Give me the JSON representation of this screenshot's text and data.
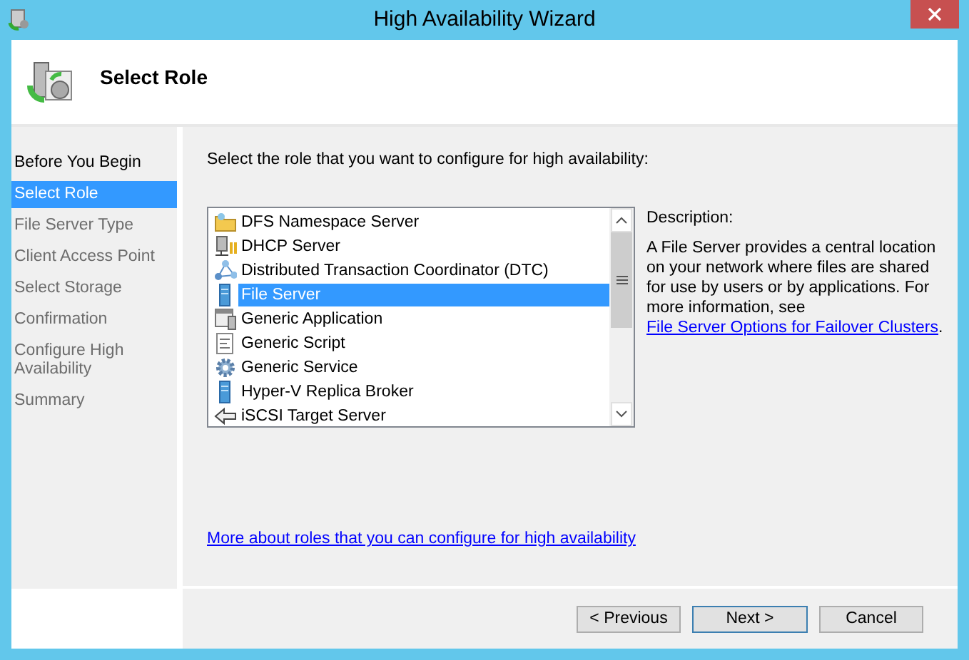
{
  "window": {
    "title": "High Availability Wizard"
  },
  "header": {
    "title": "Select Role"
  },
  "steps": [
    {
      "label": "Before You Begin",
      "selected": false,
      "disabled": false
    },
    {
      "label": "Select Role",
      "selected": true,
      "disabled": false
    },
    {
      "label": "File Server Type",
      "selected": false,
      "disabled": true
    },
    {
      "label": "Client Access Point",
      "selected": false,
      "disabled": true
    },
    {
      "label": "Select Storage",
      "selected": false,
      "disabled": true
    },
    {
      "label": "Confirmation",
      "selected": false,
      "disabled": true
    },
    {
      "label": "Configure High Availability",
      "selected": false,
      "disabled": true
    },
    {
      "label": "Summary",
      "selected": false,
      "disabled": true
    }
  ],
  "instruction": "Select the role that you want to configure for high availability:",
  "roles": [
    {
      "label": "DFS Namespace Server",
      "kind": "folder",
      "selected": false
    },
    {
      "label": "DHCP Server",
      "kind": "network",
      "selected": false
    },
    {
      "label": "Distributed Transaction Coordinator (DTC)",
      "kind": "nodes",
      "selected": false
    },
    {
      "label": "File Server",
      "kind": "server",
      "selected": true
    },
    {
      "label": "Generic Application",
      "kind": "application",
      "selected": false
    },
    {
      "label": "Generic Script",
      "kind": "script",
      "selected": false
    },
    {
      "label": "Generic Service",
      "kind": "gear",
      "selected": false
    },
    {
      "label": "Hyper-V Replica Broker",
      "kind": "server",
      "selected": false
    },
    {
      "label": "iSCSI Target Server",
      "kind": "arrow",
      "selected": false
    }
  ],
  "description": {
    "heading": "Description:",
    "text": "A File Server provides a central location on your network where files are shared for use by users or by applications. For more information, see ",
    "link": "File Server Options for Failover Clusters",
    "after": "."
  },
  "more_link": "More about roles that you can configure for high availability",
  "buttons": [
    {
      "label": "< Previous",
      "kind": "normal"
    },
    {
      "label": "Next >",
      "kind": "default"
    },
    {
      "label": "Cancel",
      "kind": "normal"
    }
  ]
}
